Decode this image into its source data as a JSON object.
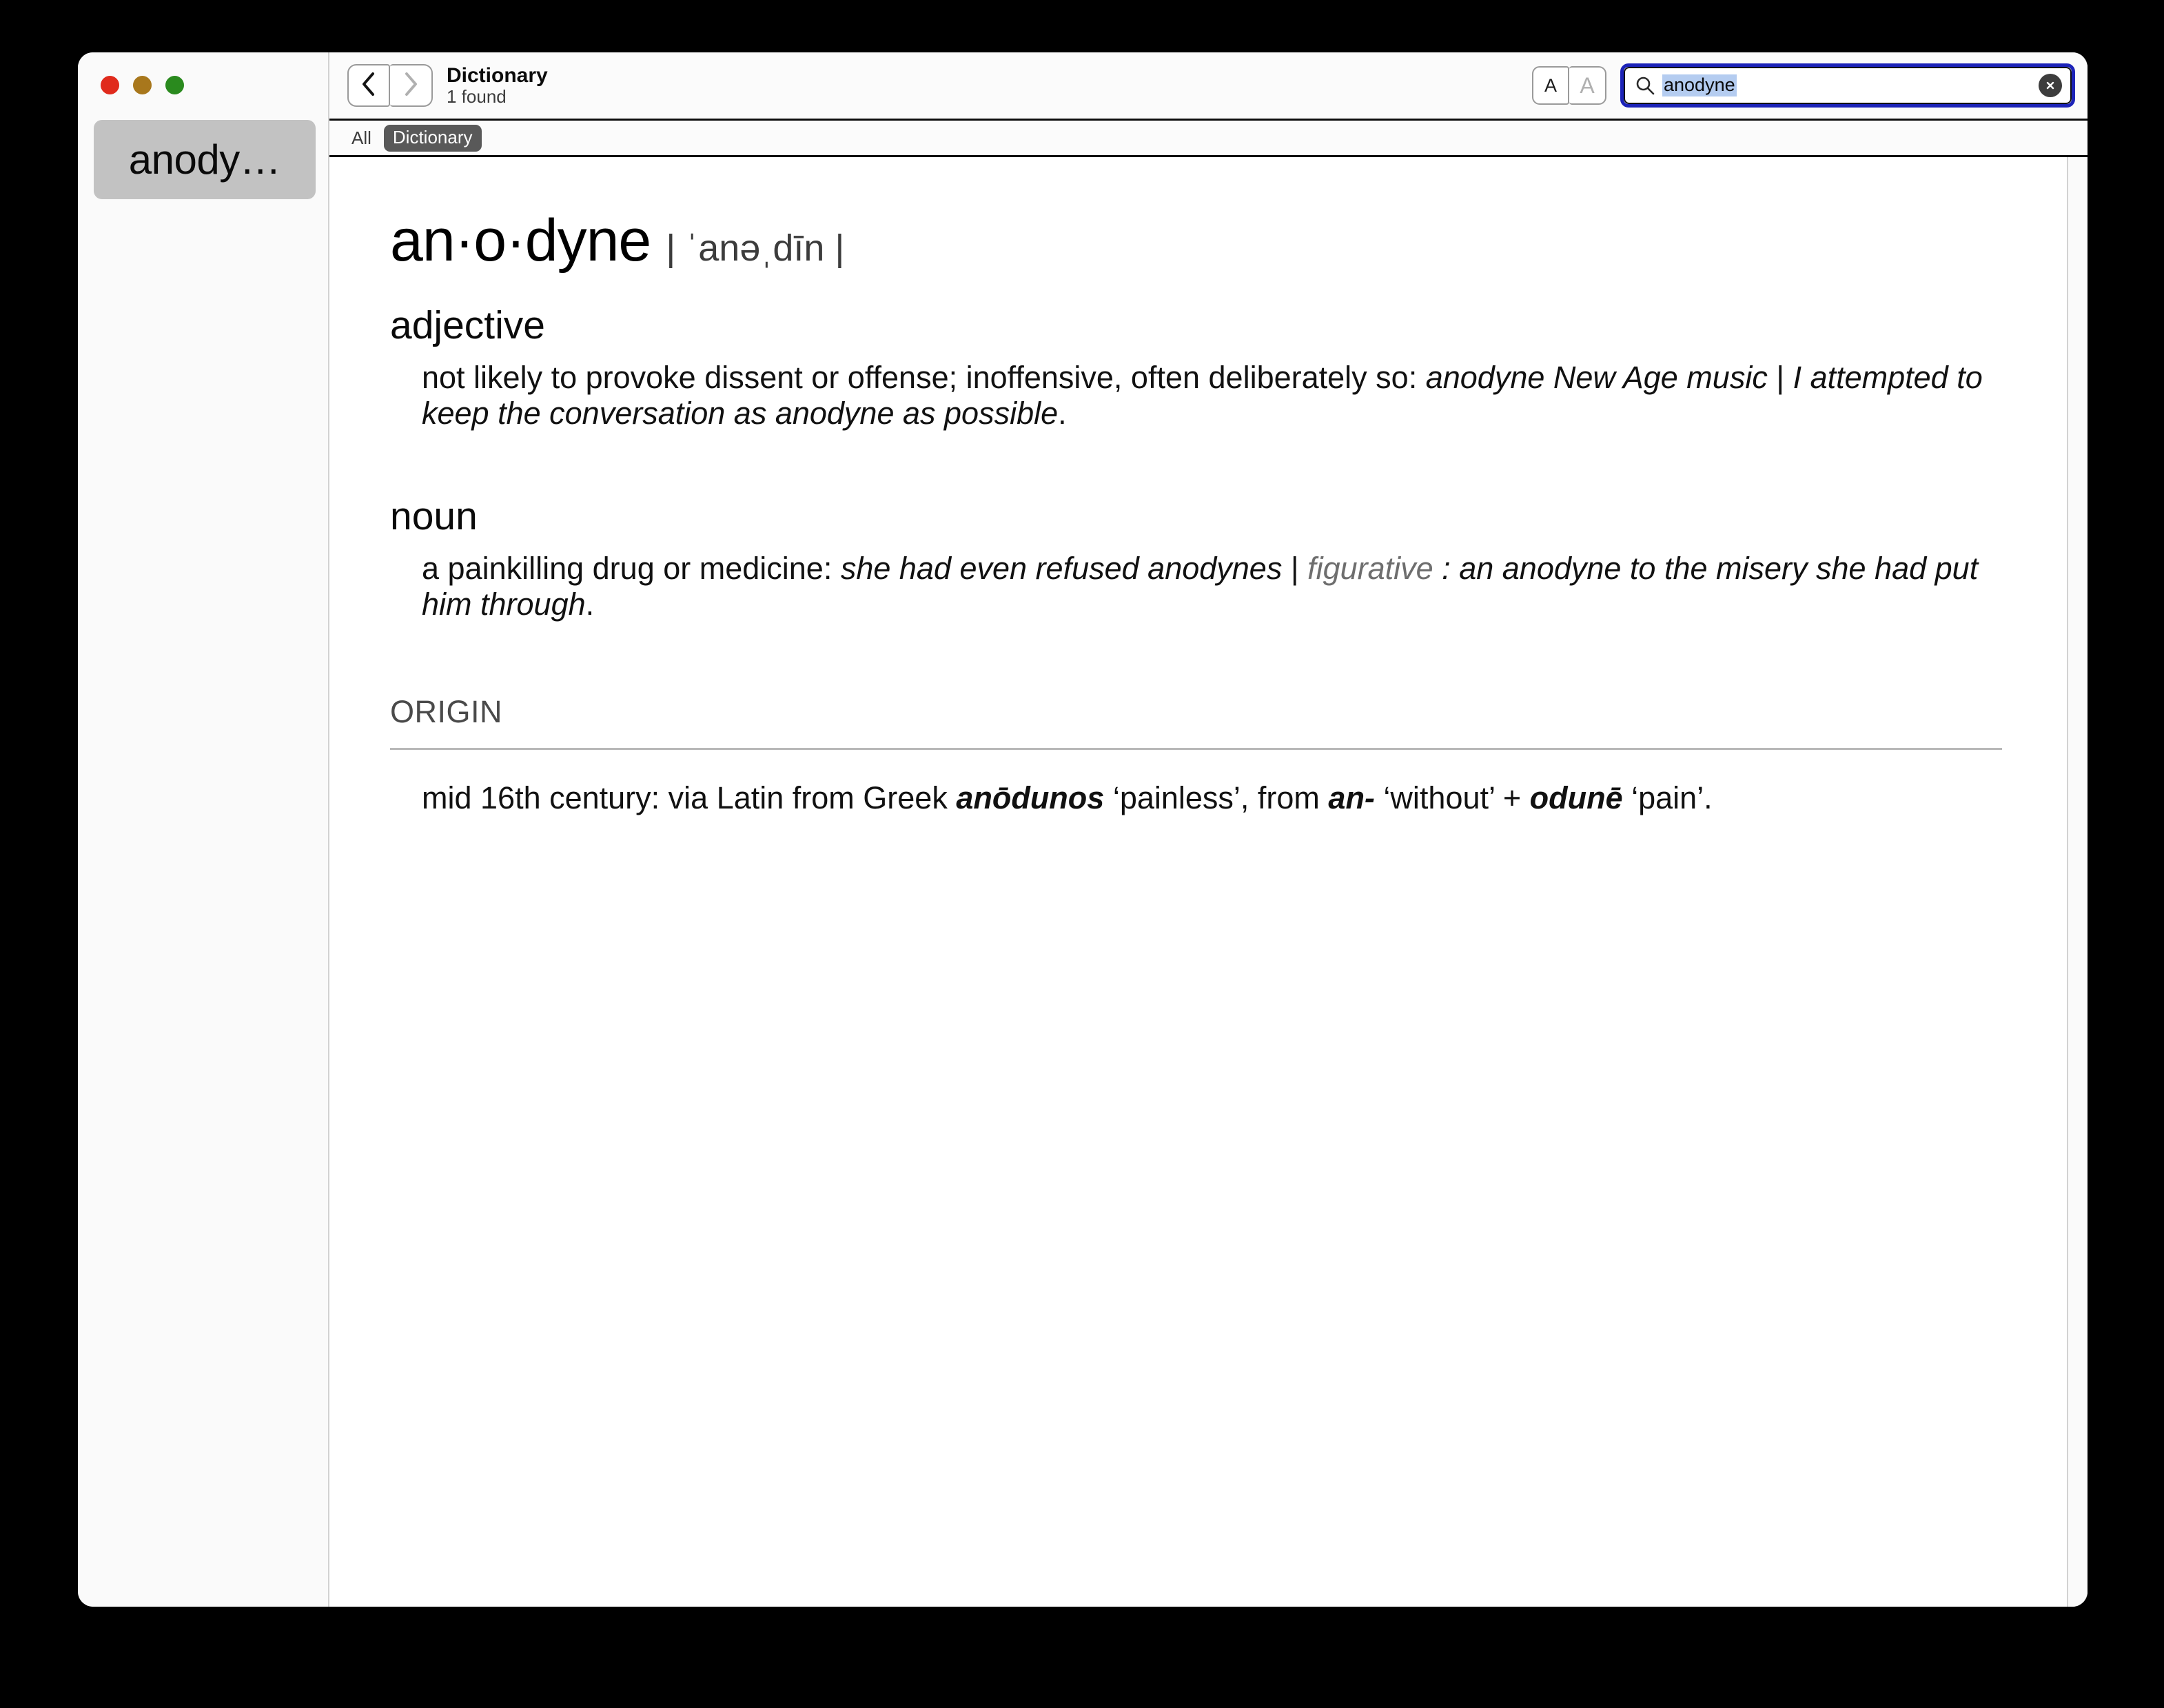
{
  "window": {
    "traffic_lights": [
      {
        "name": "close",
        "color": "#e02a1c"
      },
      {
        "name": "minimize",
        "color": "#a8771c"
      },
      {
        "name": "maximize",
        "color": "#2a8a1e"
      }
    ]
  },
  "sidebar": {
    "items": [
      {
        "label": "anody…",
        "selected": true
      }
    ]
  },
  "toolbar": {
    "back_icon": "chevron-left-icon",
    "forward_icon": "chevron-right-icon",
    "title": "Dictionary",
    "subtitle": "1 found",
    "font_size_small_label": "A",
    "font_size_large_label": "A",
    "search": {
      "icon": "search-icon",
      "value": "anodyne",
      "placeholder": "Search",
      "clear_label": "✕",
      "selection_color": "#b4ccf0",
      "focus_ring_color": "#1c23b8"
    }
  },
  "scope_bar": {
    "tabs": [
      {
        "label": "All",
        "selected": false
      },
      {
        "label": "Dictionary",
        "selected": true
      }
    ],
    "selected_color": "#595959"
  },
  "entry": {
    "headword": "an·o·dyne",
    "pronunciation": "| ˈanəˌdīn |",
    "senses": [
      {
        "pos": "adjective",
        "definition": "not likely to provoke dissent or offense; inoffensive, often deliberately so:",
        "example_1": "anodyne New Age music",
        "separator": "|",
        "example_2": "I attempted to keep the conversation as anodyne as possible",
        "terminator": "."
      },
      {
        "pos": "noun",
        "definition": "a painkilling drug or medicine:",
        "example_1": "she had even refused anodynes",
        "separator": "|",
        "register_label": "figurative",
        "register_colon": ":",
        "example_2": "an anodyne to the misery she had put him through",
        "terminator": "."
      }
    ],
    "origin": {
      "heading": "ORIGIN",
      "text_1": "mid 16th century: via Latin from Greek ",
      "greek_1": "anōdunos",
      "gloss_1": " ‘painless’, from ",
      "greek_2": "an-",
      "gloss_2": " ‘without’ + ",
      "greek_3": "odunē",
      "gloss_3": " ‘pain’."
    }
  }
}
